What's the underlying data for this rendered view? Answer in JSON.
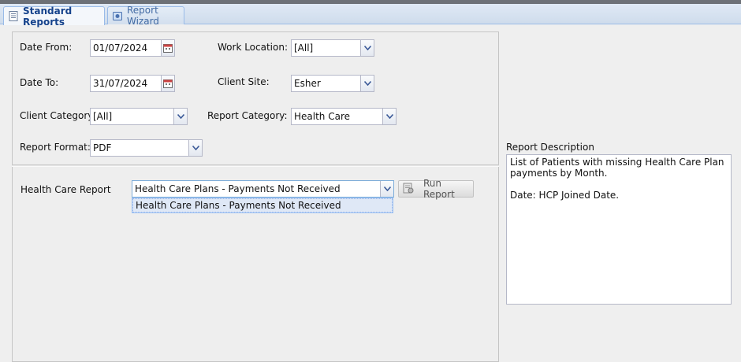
{
  "tabs": [
    {
      "label": "Standard Reports",
      "active": true,
      "icon": "report-page-icon"
    },
    {
      "label": "Report Wizard",
      "active": false,
      "icon": "wizard-icon"
    }
  ],
  "filters": {
    "date_from": {
      "label": "Date From:",
      "value": "01/07/2024"
    },
    "date_to": {
      "label": "Date To:",
      "value": "31/07/2024"
    },
    "work_location": {
      "label": "Work Location:",
      "value": "[All]"
    },
    "client_site": {
      "label": "Client Site:",
      "value": "Esher"
    },
    "client_category": {
      "label": "Client Category:",
      "value": "[All]"
    },
    "report_category": {
      "label": "Report Category:",
      "value": "Health Care"
    },
    "report_format": {
      "label": "Report Format:",
      "value": "PDF"
    }
  },
  "report": {
    "label": "Health Care Report",
    "value": "Health Care Plans - Payments Not Received",
    "options": [
      "Health Care Plans - Payments Not Received"
    ],
    "run_button": "Run Report"
  },
  "description": {
    "label": "Report Description",
    "text": "List of Patients with missing Health Care Plan\npayments by Month.\n\nDate: HCP Joined Date."
  },
  "colors": {
    "accent": "#15428b",
    "tab_border": "#99bbe8",
    "selection": "#dfe8f6"
  }
}
